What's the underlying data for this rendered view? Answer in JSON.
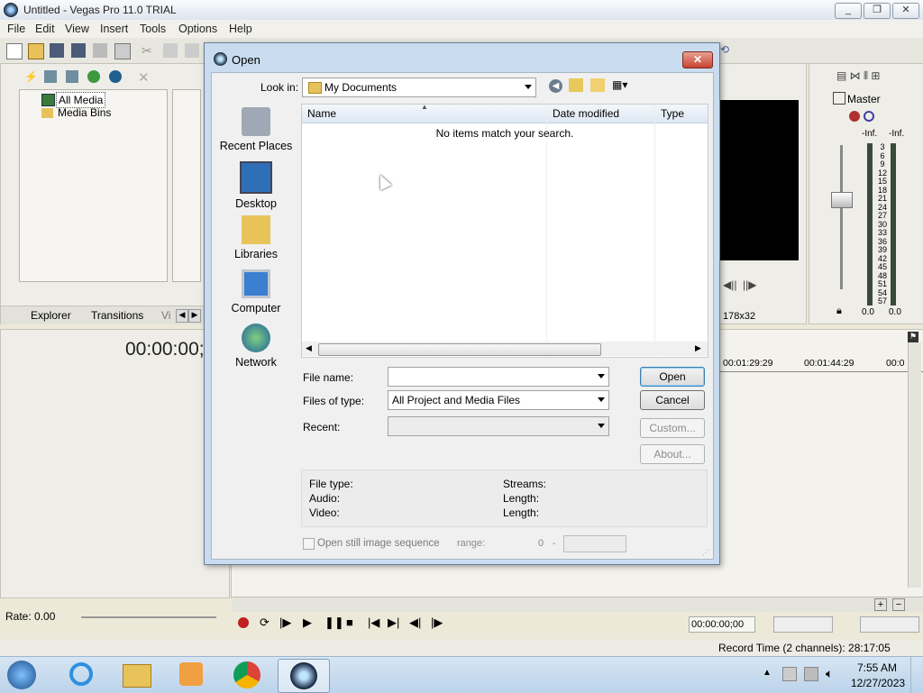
{
  "app": {
    "title": "Untitled - Vegas Pro 11.0 TRIAL",
    "window_buttons": [
      "minimize",
      "restore",
      "close"
    ]
  },
  "menu": [
    "File",
    "Edit",
    "View",
    "Insert",
    "Tools",
    "Options",
    "Help"
  ],
  "explorer": {
    "tree": [
      "All Media",
      "Media Bins"
    ],
    "tabs": [
      "Explorer",
      "Transitions",
      "Vi"
    ]
  },
  "timecode": "00:00:00;",
  "preview": {
    "size": "178x32"
  },
  "mixer": {
    "title": "Master",
    "peak_left": "-Inf.",
    "peak_right": "-Inf.",
    "scale": [
      "3",
      "6",
      "9",
      "12",
      "15",
      "18",
      "21",
      "24",
      "27",
      "30",
      "33",
      "36",
      "39",
      "42",
      "45",
      "48",
      "51",
      "54",
      "57"
    ],
    "level_left": "0.0",
    "level_right": "0.0"
  },
  "timeline": {
    "ruler": [
      "00:01:29:29",
      "00:01:44:29",
      "00:0"
    ],
    "rate": "Rate: 0.00",
    "transport_time": "00:00:00;00"
  },
  "status": {
    "record_time": "Record Time (2 channels): 28:17:05"
  },
  "dialog": {
    "title": "Open",
    "look_in_label": "Look in:",
    "look_in_value": "My Documents",
    "places": [
      "Recent Places",
      "Desktop",
      "Libraries",
      "Computer",
      "Network"
    ],
    "columns": [
      "Name",
      "Date modified",
      "Type"
    ],
    "empty_message": "No items match your search.",
    "file_name_label": "File name:",
    "file_name_value": "",
    "files_of_type_label": "Files of type:",
    "files_of_type_value": "All Project and Media Files",
    "recent_label": "Recent:",
    "recent_value": "",
    "buttons": {
      "open": "Open",
      "cancel": "Cancel",
      "custom": "Custom...",
      "about": "About..."
    },
    "info": {
      "file_type": "File type:",
      "audio": "Audio:",
      "video": "Video:",
      "streams": "Streams:",
      "length1": "Length:",
      "length2": "Length:"
    },
    "still_sequence": "Open still image sequence",
    "range_label": "range:",
    "range_from": "0",
    "range_sep": "-"
  },
  "taskbar": {
    "items": [
      "start-orb",
      "internet-explorer",
      "windows-explorer",
      "media-player",
      "chrome",
      "vegas-pro"
    ],
    "time": "7:55 AM",
    "date": "12/27/2023"
  }
}
